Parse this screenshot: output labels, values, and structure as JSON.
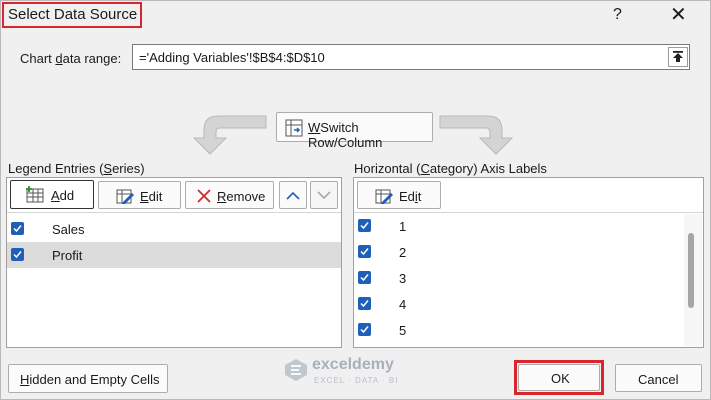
{
  "window": {
    "title": "Select Data Source",
    "help_glyph": "?",
    "close_glyph": "✕"
  },
  "chart_range": {
    "label_pre": "Chart ",
    "label_key": "d",
    "label_post": "ata range:",
    "value": "='Adding Variables'!$B$4:$D$10"
  },
  "switch_button": {
    "key": "W",
    "rest": "Switch Row/Column"
  },
  "legend": {
    "heading_pre": "Legend Entries (",
    "heading_key": "S",
    "heading_post": "eries)",
    "add_key": "A",
    "add_rest": "dd",
    "edit_key": "E",
    "edit_rest": "dit",
    "remove_key": "R",
    "remove_rest": "emove",
    "items": [
      {
        "label": "Sales",
        "checked": true,
        "selected": false
      },
      {
        "label": "Profit",
        "checked": true,
        "selected": true
      }
    ]
  },
  "axis": {
    "heading_pre": "Horizontal (",
    "heading_key": "C",
    "heading_post": "ategory) Axis Labels",
    "edit_pre": "Ed",
    "edit_key": "i",
    "edit_post": "t",
    "items": [
      "1",
      "2",
      "3",
      "4",
      "5"
    ]
  },
  "footer": {
    "hidden_key": "H",
    "hidden_rest": "idden and Empty Cells",
    "ok": "OK",
    "cancel": "Cancel"
  },
  "watermark": {
    "name": "exceldemy",
    "tag": "EXCEL · DATA · BI"
  },
  "colors": {
    "accent": "#1f5fb7",
    "highlight_red": "#d9262c",
    "selected_row": "#dcdcdc"
  }
}
